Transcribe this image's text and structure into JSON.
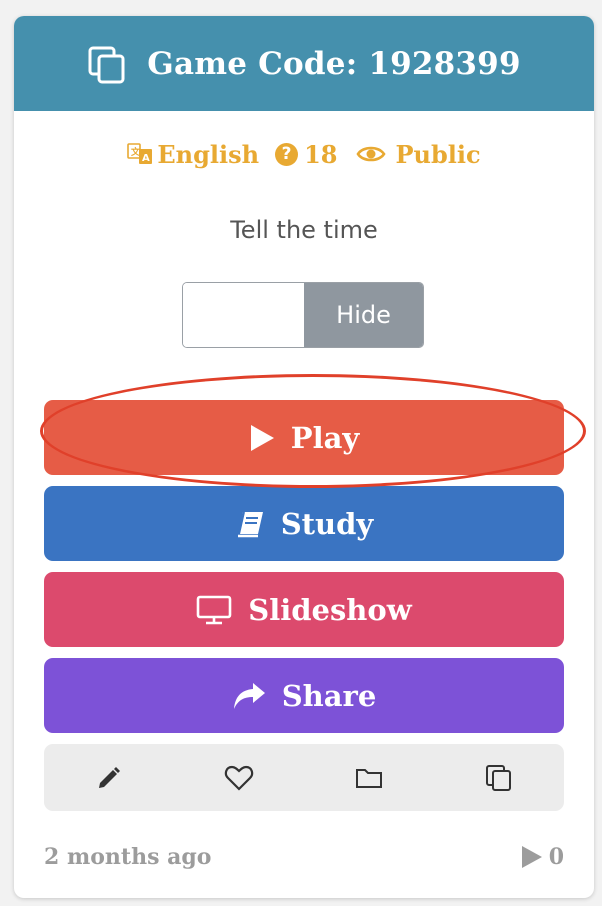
{
  "header": {
    "title": "Game Code: 1928399",
    "icon": "copy-icon",
    "background": "#4590ad"
  },
  "meta": {
    "language": "English",
    "language_icon": "translate-icon",
    "question_count": "18",
    "question_icon": "question-circle-icon",
    "visibility": "Public",
    "visibility_icon": "eye-icon",
    "color": "#e8a932"
  },
  "subtitle": "Tell the time",
  "toggle": {
    "label": "Hide"
  },
  "buttons": {
    "play": {
      "label": "Play",
      "icon": "play-icon",
      "color": "#e65c46"
    },
    "study": {
      "label": "Study",
      "icon": "book-icon",
      "color": "#3a74c2"
    },
    "slideshow": {
      "label": "Slideshow",
      "icon": "monitor-icon",
      "color": "#dc4a6d"
    },
    "share": {
      "label": "Share",
      "icon": "share-arrow-icon",
      "color": "#7d52d7"
    }
  },
  "toolbar": {
    "tools": [
      "pencil-icon",
      "heart-icon",
      "folder-icon",
      "copy-icon"
    ]
  },
  "footer": {
    "date": "2 months ago",
    "plays": "0",
    "plays_icon": "play-icon"
  },
  "annotation": {
    "highlight_color": "#e0402a"
  }
}
